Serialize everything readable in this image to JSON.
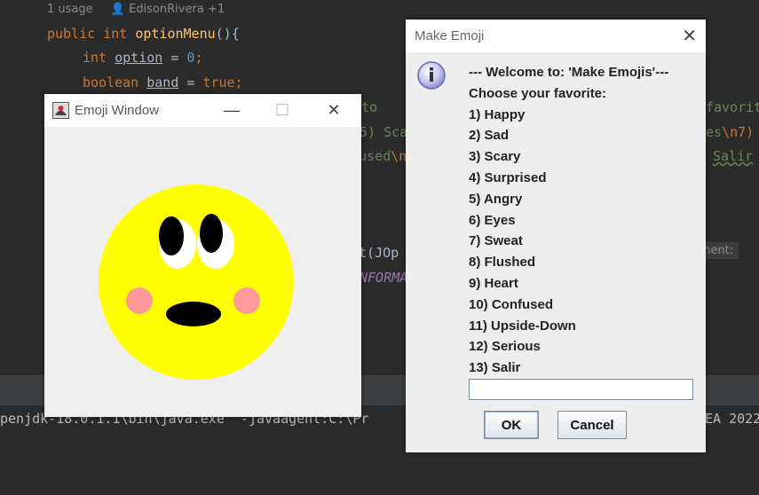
{
  "ide": {
    "usage_hint": "1 usage",
    "author_hint": "EdisonRivera +1",
    "line1": {
      "kw1": "public",
      "kw2": "int",
      "method": "optionMenu",
      "rest": "(){"
    },
    "line2": {
      "kw": "int",
      "var": "option",
      "eq": " = ",
      "num": "0",
      "end": ";"
    },
    "line3": {
      "kw": "boolean",
      "var": "band",
      "eq": " = ",
      "val": "true",
      "end": ";"
    },
    "frag_me_to": "me to",
    "frag_favorit": "favorit",
    "frag_sc": "5) Sca",
    "frag_es": "es",
    "frag_n7": "\\n7)",
    "frag_fused": "fused",
    "frag_n": "\\n",
    "frag_salir": "Salir",
    "frag_joptional": "nt(JOp",
    "frag_informa": "NFORMA",
    "param_hint": "ponent:",
    "console_line": "penjdk-18.0.1.1\\bin\\java.exe \"-javaagent:C:\\Pr",
    "console_tail": "EA 2022"
  },
  "emoji_window": {
    "title": "Emoji Window",
    "minimize": "—",
    "maximize": "☐",
    "close": "✕",
    "face_color": "#ffff00",
    "cheek_color": "#ff9a9a"
  },
  "dialog": {
    "title": "Make Emoji",
    "close": "✕",
    "lines": [
      "--- Welcome to: 'Make Emojis'---",
      "Choose your favorite:",
      "1) Happy",
      "2) Sad",
      "3) Scary",
      "4) Surprised",
      "5) Angry",
      "6) Eyes",
      "7) Sweat",
      "8) Flushed",
      "9) Heart",
      "10) Confused",
      "11) Upside-Down",
      "12) Serious",
      "13) Salir"
    ],
    "input_value": "",
    "ok_label": "OK",
    "cancel_label": "Cancel"
  }
}
